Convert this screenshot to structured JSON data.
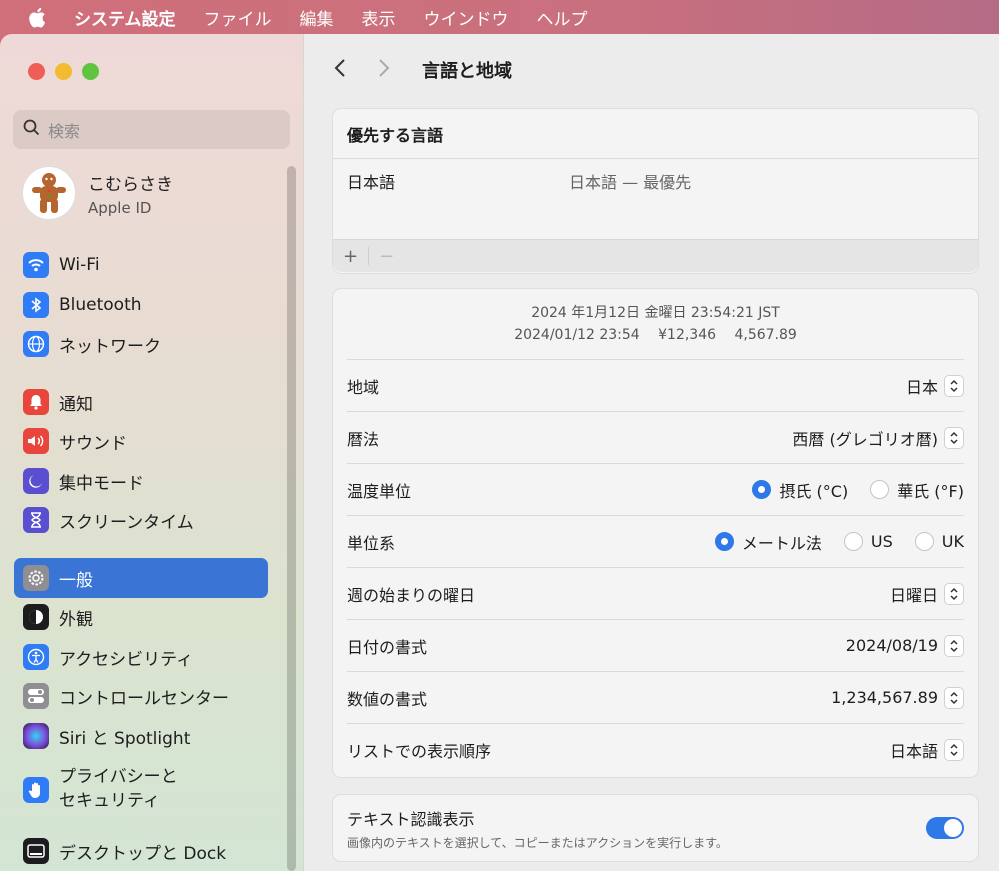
{
  "menubar": {
    "app": "システム設定",
    "items": [
      "ファイル",
      "編集",
      "表示",
      "ウインドウ",
      "ヘルプ"
    ]
  },
  "sidebar": {
    "search_placeholder": "検索",
    "account": {
      "name": "こむらさき",
      "sub": "Apple ID"
    },
    "items": [
      {
        "label": "Wi-Fi",
        "icon": "wifi-icon",
        "color": "#2f7cf6"
      },
      {
        "label": "Bluetooth",
        "icon": "bluetooth-icon",
        "color": "#2f7cf6"
      },
      {
        "label": "ネットワーク",
        "icon": "globe-icon",
        "color": "#2f7cf6"
      },
      {
        "label": "通知",
        "icon": "bell-icon",
        "color": "#e8453c"
      },
      {
        "label": "サウンド",
        "icon": "speaker-icon",
        "color": "#e8453c"
      },
      {
        "label": "集中モード",
        "icon": "moon-icon",
        "color": "#5a4fcf"
      },
      {
        "label": "スクリーンタイム",
        "icon": "hourglass-icon",
        "color": "#5a4fcf"
      },
      {
        "label": "一般",
        "icon": "gear-icon",
        "color": "#8e8e93"
      },
      {
        "label": "外観",
        "icon": "appearance-icon",
        "color": "#1c1c1e"
      },
      {
        "label": "アクセシビリティ",
        "icon": "accessibility-icon",
        "color": "#2f7cf6"
      },
      {
        "label": "コントロールセンター",
        "icon": "control-center-icon",
        "color": "#8e8e93"
      },
      {
        "label": "Siri と Spotlight",
        "icon": "siri-icon",
        "color": "#6b3fa0"
      },
      {
        "label": "プライバシーと",
        "label2": "セキュリティ",
        "icon": "hand-icon",
        "color": "#2f7cf6"
      },
      {
        "label": "デスクトップと Dock",
        "icon": "dock-icon",
        "color": "#1c1c1e"
      }
    ]
  },
  "main": {
    "title": "言語と地域",
    "languages": {
      "header": "優先する言語",
      "rows": [
        {
          "name": "日本語",
          "detail": "日本語 — 最優先"
        }
      ],
      "add": "+",
      "remove": "−"
    },
    "preview": {
      "line1": "2024 年1月12日 金曜日 23:54:21 JST",
      "line2": "2024/01/12 23:54　 ¥12,346　 4,567.89"
    },
    "settings": {
      "region": {
        "label": "地域",
        "value": "日本"
      },
      "calendar": {
        "label": "暦法",
        "value": "西暦 (グレゴリオ暦)"
      },
      "temperature": {
        "label": "温度単位",
        "opt1": "摂氏 (°C)",
        "opt2": "華氏 (°F)",
        "selected": "摂氏 (°C)"
      },
      "measurement": {
        "label": "単位系",
        "opt1": "メートル法",
        "opt2": "US",
        "opt3": "UK",
        "selected": "メートル法"
      },
      "first_day": {
        "label": "週の始まりの曜日",
        "value": "日曜日"
      },
      "date_format": {
        "label": "日付の書式",
        "value": "2024/08/19"
      },
      "number_format": {
        "label": "数値の書式",
        "value": "1,234,567.89"
      },
      "list_order": {
        "label": "リストでの表示順序",
        "value": "日本語"
      }
    },
    "live_text": {
      "title": "テキスト認識表示",
      "desc": "画像内のテキストを選択して、コピーまたはアクションを実行します。",
      "enabled": true
    }
  }
}
